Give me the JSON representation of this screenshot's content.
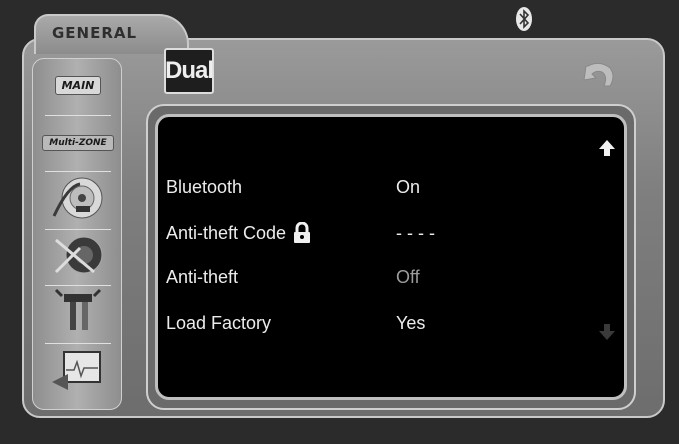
{
  "header": {
    "section_title": "GENERAL",
    "logo_text": "Dual"
  },
  "sidebar": {
    "items": [
      {
        "label": "MAIN"
      },
      {
        "label": "Multi-ZONE"
      }
    ]
  },
  "settings": {
    "rows": [
      {
        "label": "Bluetooth",
        "value": "On"
      },
      {
        "label": "Anti-theft Code",
        "value": "- - - -"
      },
      {
        "label": "Anti-theft",
        "value": "Off"
      },
      {
        "label": "Load Factory",
        "value": "Yes"
      }
    ]
  }
}
